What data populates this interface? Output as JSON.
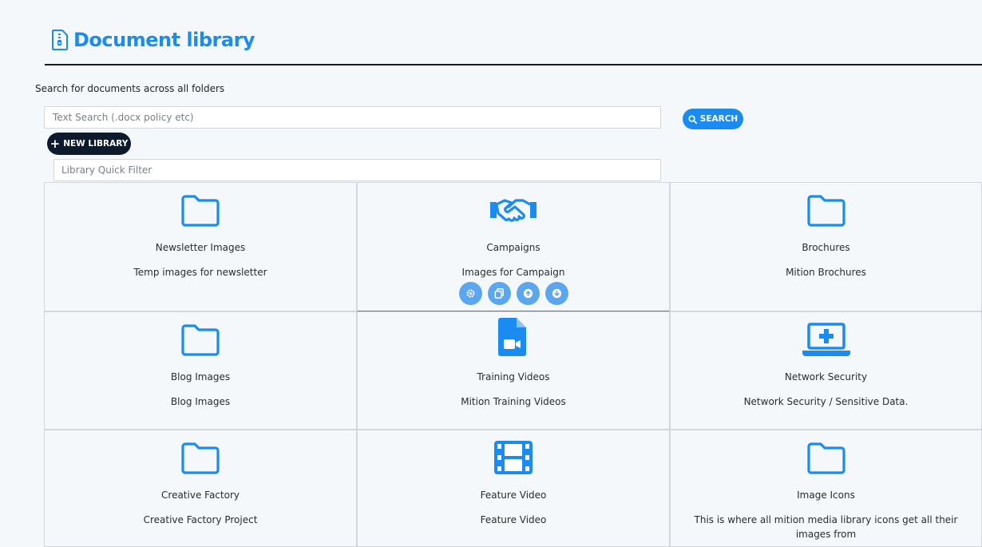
{
  "header": {
    "title": "Document library"
  },
  "search": {
    "caption": "Search for documents across all folders",
    "placeholder": "Text Search (.docx policy etc)",
    "button_label": "SEARCH"
  },
  "toolbar": {
    "new_library_label": "NEW LIBRARY"
  },
  "filter": {
    "placeholder": "Library Quick Filter"
  },
  "colors": {
    "accent": "#1a8bf0",
    "dark": "#0d1a2e",
    "action": "#5aa7ef"
  },
  "libraries": [
    {
      "name": "Newsletter Images",
      "description": "Temp images for newsletter",
      "icon": "folder-icon"
    },
    {
      "name": "Campaigns",
      "description": "Images for Campaign",
      "icon": "handshake-icon",
      "actions": [
        "settings-icon",
        "copy-icon",
        "upload-icon",
        "download-icon"
      ]
    },
    {
      "name": "Brochures",
      "description": "Mition Brochures",
      "icon": "folder-icon"
    },
    {
      "name": "Blog Images",
      "description": "Blog Images",
      "icon": "folder-icon"
    },
    {
      "name": "Training Videos",
      "description": "Mition Training Videos",
      "icon": "video-file-icon"
    },
    {
      "name": "Network Security",
      "description": "Network Security / Sensitive Data.",
      "icon": "laptop-medical-icon"
    },
    {
      "name": "Creative Factory",
      "description": "Creative Factory Project",
      "icon": "folder-icon"
    },
    {
      "name": "Feature Video",
      "description": "Feature Video",
      "icon": "film-icon"
    },
    {
      "name": "Image Icons",
      "description": "This is where all mition media library icons get all their images from",
      "icon": "folder-icon"
    }
  ]
}
